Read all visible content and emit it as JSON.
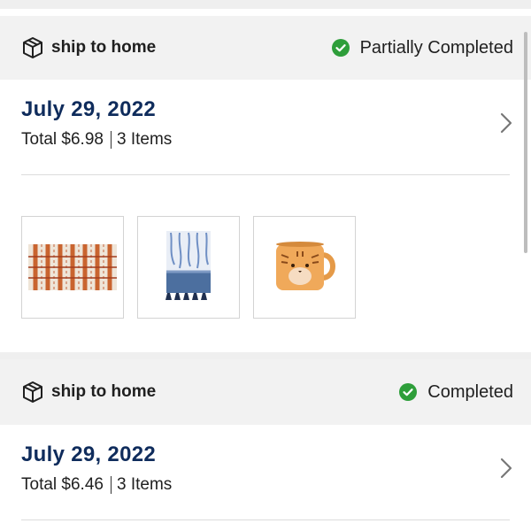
{
  "orders": [
    {
      "delivery_label": "ship to home",
      "status": "Partially Completed",
      "date": "July 29, 2022",
      "total": "Total $6.98",
      "items": "3 Items",
      "thumbnails": [
        "striped-rug-icon",
        "tie-dye-towel-icon",
        "tiger-mug-icon"
      ]
    },
    {
      "delivery_label": "ship to home",
      "status": "Completed",
      "date": "July 29, 2022",
      "total": "Total $6.46",
      "items": "3 Items"
    }
  ],
  "colors": {
    "date": "#0f2c5c",
    "status_check": "#2e9e3a",
    "header_bg": "#f2f2f2"
  }
}
